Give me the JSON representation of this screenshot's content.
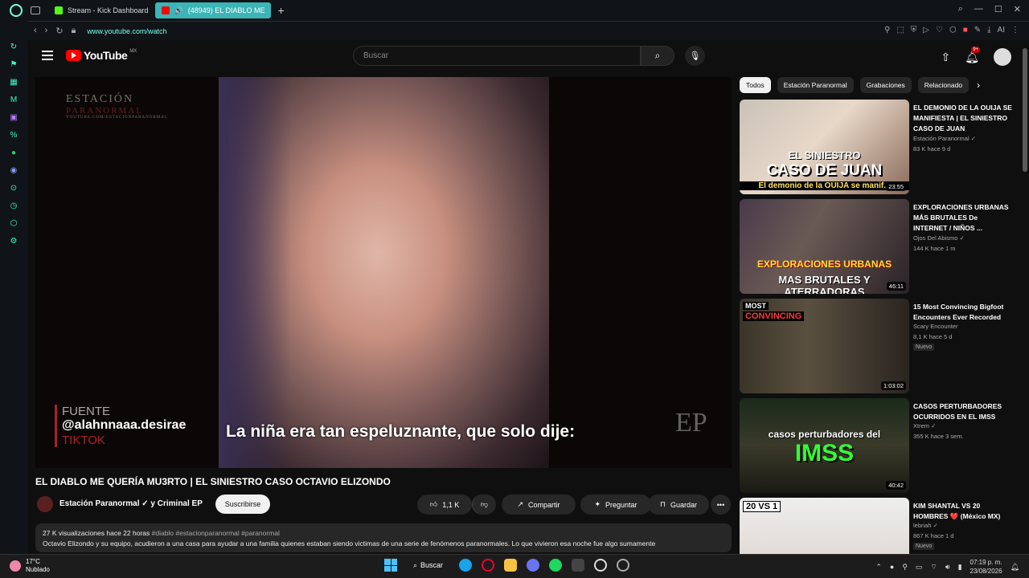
{
  "browser": {
    "tabs": [
      {
        "label": "Stream - Kick Dashboard"
      },
      {
        "label": "(48949) EL DIABLO ME"
      }
    ],
    "url": "www.youtube.com/watch",
    "new_tab": "+"
  },
  "youtube": {
    "logo_text": "YouTube",
    "country": "MX",
    "search_placeholder": "Buscar",
    "notif_count": "9+"
  },
  "video": {
    "watermark_l1": "ESTACIÓN",
    "watermark_l2": "PARANORMAL",
    "watermark_l3": "YOUTUBE.COM/ESTACIONPARANORMAL",
    "source_label": "FUENTE",
    "source_handle": "@alahnnaaa.desirae",
    "source_platform": "TIKTOK",
    "subtitle": "La niña era tan espeluznante, que solo dije:",
    "corner_logo": "EP",
    "title": "EL DIABLO ME QUERÍA MU3RTO | EL SINIESTRO CASO OCTAVIO ELIZONDO",
    "channel": "Estación Paranormal ✓ y Criminal EP",
    "subscribe": "Suscribirse",
    "likes": "1,1 K",
    "share": "Compartir",
    "ask": "Preguntar",
    "save": "Guardar",
    "more": "•••",
    "views_meta": "27 K visualizaciones  hace 22 horas",
    "hashtags": "#diablo #estacionparanormal #paranormal",
    "description": "Octavio Elizondo y su equipo, acudieron a una casa para ayudar a una familia quienes estaban siendo victimas de una serie de fenómenos paranormales. Lo que vivieron esa noche fue algo sumamente"
  },
  "chips": [
    "Todos",
    "Estación Paranormal",
    "Grabaciones",
    "Relacionado"
  ],
  "recommendations": [
    {
      "title": "EL DEMONIO DE LA OUIJA SE MANIFIESTA | EL SINIESTRO CASO DE JUAN",
      "channel": "Estación Paranormal ✓",
      "meta": "83 K  hace 9 d",
      "duration": "23:55",
      "thumb_l1": "EL SINIESTRO",
      "thumb_l2": "CASO DE JUAN",
      "thumb_l3": "El demonio de la OUIJA se manif..."
    },
    {
      "title": "EXPLORACIONES URBANAS MÁS BRUTALES De INTERNET / NIÑOS ...",
      "channel": "Ojos Del Abismo ✓",
      "meta": "144 K  hace 1 m",
      "duration": "46:11",
      "thumb_l1": "EXPLORACIONES URBANAS",
      "thumb_l2": "MAS BRUTALES Y ATERRADORAS"
    },
    {
      "title": "15 Most Convincing Bigfoot Encounters Ever Recorded",
      "channel": "Scary Encounter",
      "meta": "8,1 K  hace 5 d",
      "badge": "Nuevo",
      "duration": "1:03:02",
      "thumb_l1": "MOST",
      "thumb_l2": "CONVINCING"
    },
    {
      "title": "CASOS PERTURBADORES OCURRIDOS EN EL IMSS",
      "channel": "Xtrem ✓",
      "meta": "355 K  hace 3 sem.",
      "duration": "40:42",
      "thumb_l1": "casos perturbadores del",
      "thumb_l2": "IMSS"
    },
    {
      "title": "KIM SHANTAL VS 20 HOMBRES ❤️ (México MX)",
      "channel": "lebriah ✓",
      "meta": "867 K  hace 1 d",
      "badge": "Nuevo",
      "thumb_l1": "20 VS 1"
    }
  ],
  "taskbar": {
    "temp": "17°C",
    "weather": "Nublado",
    "search": "Buscar",
    "time": "07:19 p. m.",
    "date": "23/08/2026"
  }
}
